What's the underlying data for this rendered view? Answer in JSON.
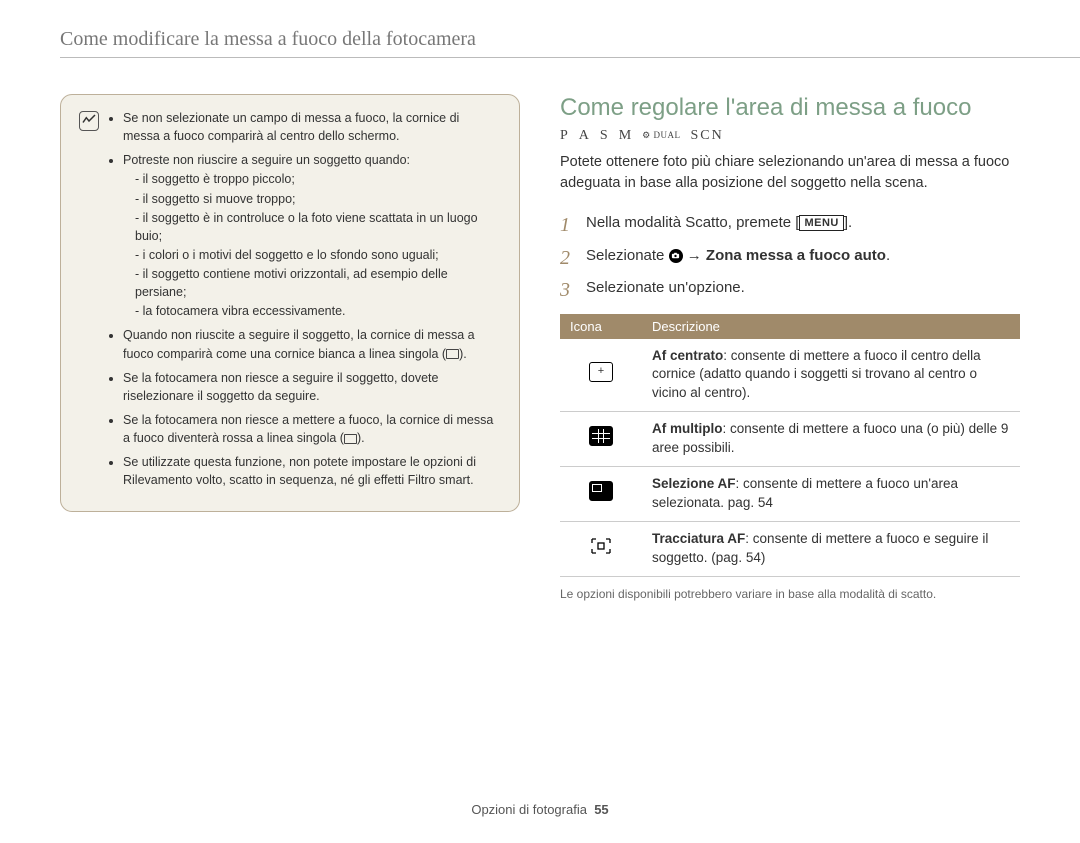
{
  "header": {
    "breadcrumb": "Come modificare la messa a fuoco della fotocamera"
  },
  "note_box": {
    "badge": "✓",
    "items": [
      "Se non selezionate un campo di messa a fuoco, la cornice di messa a fuoco comparirà al centro dello schermo.",
      "Potreste non riuscire a seguire un soggetto quando:",
      "Quando non riuscite a seguire il soggetto, la cornice di messa a fuoco comparirà come una cornice bianca a linea singola (",
      "Se la fotocamera non riesce a seguire il soggetto, dovete riselezionare il soggetto da seguire.",
      "Se la fotocamera non riesce a mettere a fuoco, la cornice di messa a fuoco diventerà rossa a linea singola (",
      "Se utilizzate questa funzione, non potete impostare le opzioni di Rilevamento volto, scatto in sequenza, né gli effetti Filtro smart."
    ],
    "item2_closing": ").",
    "item4_closing": ").",
    "sub_items": [
      "il soggetto è troppo piccolo;",
      "il soggetto si muove troppo;",
      "il soggetto è in controluce o la foto viene scattata in un luogo buio;",
      "i colori o i motivi del soggetto e lo sfondo sono uguali;",
      "il soggetto contiene motivi orizzontali, ad esempio delle persiane;",
      "la fotocamera vibra eccessivamente."
    ]
  },
  "section": {
    "title": "Come regolare l'area di messa a fuoco",
    "modes": {
      "p": "P",
      "a": "A",
      "s": "S",
      "m": "M",
      "dual": "DUAL",
      "scn": "SCN"
    },
    "lead": "Potete ottenere foto più chiare selezionando un'area di messa a fuoco adeguata in base alla posizione del soggetto nella scena.",
    "steps": {
      "s1_pre": "Nella modalità Scatto, premete [",
      "s1_key": "MENU",
      "s1_post": "].",
      "s2_pre": "Selezionate ",
      "s2_arrow": " → ",
      "s2_bold": "Zona messa a fuoco auto",
      "s2_post": ".",
      "s3": "Selezionate un'opzione."
    },
    "table": {
      "col_icon": "Icona",
      "col_desc": "Descrizione",
      "rows": [
        {
          "name": "Af centrato",
          "desc": ": consente di mettere a fuoco il centro della cornice (adatto quando i soggetti si trovano al centro o vicino al centro)."
        },
        {
          "name": "Af multiplo",
          "desc": ": consente di mettere a fuoco una (o più) delle 9 aree possibili."
        },
        {
          "name": "Selezione AF",
          "desc": ": consente di mettere a fuoco un'area selezionata. pag. 54"
        },
        {
          "name": "Tracciatura AF",
          "desc": ": consente di mettere a fuoco e seguire il soggetto. (pag. 54)"
        }
      ]
    },
    "footnote": "Le opzioni disponibili potrebbero variare in base alla modalità di scatto."
  },
  "footer": {
    "section": "Opzioni di fotografia",
    "page": "55"
  }
}
